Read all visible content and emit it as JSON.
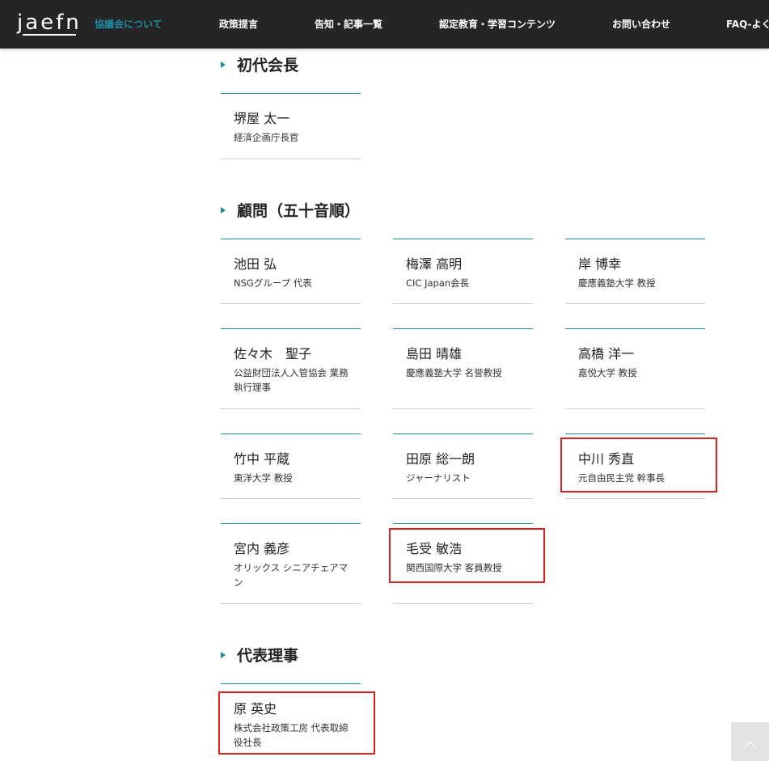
{
  "header": {
    "logo": "jaefn",
    "nav": [
      {
        "label": "協議会について",
        "active": true
      },
      {
        "label": "政策提言"
      },
      {
        "label": "告知・記事一覧"
      },
      {
        "label": "認定教育・学習コンテンツ"
      },
      {
        "label": "お問い合わせ"
      },
      {
        "label": "FAQ-よく"
      }
    ]
  },
  "colors": {
    "accent": "#1e8ca0",
    "header_bg": "#252525",
    "highlight": "#e02020"
  },
  "sections": {
    "first_chairman": {
      "heading": "初代会長",
      "members": [
        {
          "name": "堺屋 太一",
          "title": "経済企画庁長官"
        }
      ]
    },
    "advisors": {
      "heading": "顧問（五十音順）",
      "members": [
        {
          "name": "池田 弘",
          "title": "NSGグループ 代表"
        },
        {
          "name": "梅澤 高明",
          "title": "CIC Japan会長"
        },
        {
          "name": "岸 博幸",
          "title": "慶應義塾大学 教授"
        },
        {
          "name": "佐々木　聖子",
          "title": "公益財団法人入管協会 業務執行理事"
        },
        {
          "name": "島田 晴雄",
          "title": "慶應義塾大学 名誉教授"
        },
        {
          "name": "高橋 洋一",
          "title": "嘉悦大学 教授"
        },
        {
          "name": "竹中 平蔵",
          "title": "東洋大学 教授"
        },
        {
          "name": "田原 総一朗",
          "title": "ジャーナリスト"
        },
        {
          "name": "中川 秀直",
          "title": "元自由民主党 幹事長"
        },
        {
          "name": "宮内 義彦",
          "title": "オリックス シニアチェアマン"
        },
        {
          "name": "毛受 敏浩",
          "title": "関西国際大学 客員教授"
        }
      ]
    },
    "representative": {
      "heading": "代表理事",
      "members": [
        {
          "name": "原 英史",
          "title": "株式会社政策工房 代表取締役社長"
        }
      ]
    }
  },
  "scroll_top": {
    "icon": "chevron-up-icon"
  }
}
